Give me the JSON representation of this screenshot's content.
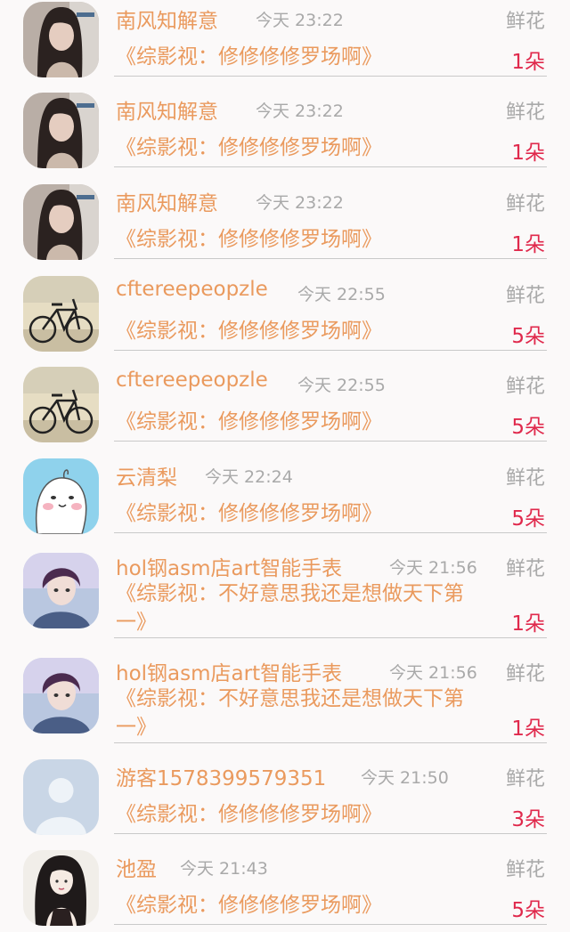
{
  "rows": [
    {
      "name": "南风知解意",
      "time": "今天 23:22",
      "gift": "鲜花",
      "book": "《综影视：修修修修罗场啊》",
      "count": "1朵",
      "avatar": "girl"
    },
    {
      "name": "南风知解意",
      "time": "今天 23:22",
      "gift": "鲜花",
      "book": "《综影视：修修修修罗场啊》",
      "count": "1朵",
      "avatar": "girl"
    },
    {
      "name": "南风知解意",
      "time": "今天 23:22",
      "gift": "鲜花",
      "book": "《综影视：修修修修罗场啊》",
      "count": "1朵",
      "avatar": "girl"
    },
    {
      "name": "cftereepeopzle",
      "time": "今天 22:55",
      "gift": "鲜花",
      "book": "《综影视：修修修修罗场啊》",
      "count": "5朵",
      "avatar": "bicycle"
    },
    {
      "name": "cftereepeopzle",
      "time": "今天 22:55",
      "gift": "鲜花",
      "book": "《综影视：修修修修罗场啊》",
      "count": "5朵",
      "avatar": "bicycle"
    },
    {
      "name": "云清梨",
      "time": "今天 22:24",
      "gift": "鲜花",
      "book": "《综影视：修修修修罗场啊》",
      "count": "5朵",
      "avatar": "cartoon"
    },
    {
      "name": "hol钢asm店art智能手表",
      "time": "今天 21:56",
      "gift": "鲜花",
      "book": "《综影视：不好意思我还是想做天下第一》",
      "count": "1朵",
      "avatar": "boy"
    },
    {
      "name": "hol钢asm店art智能手表",
      "time": "今天 21:56",
      "gift": "鲜花",
      "book": "《综影视：不好意思我还是想做天下第一》",
      "count": "1朵",
      "avatar": "boy"
    },
    {
      "name": "游客1578399579351",
      "time": "今天 21:50",
      "gift": "鲜花",
      "book": "《综影视：修修修修罗场啊》",
      "count": "3朵",
      "avatar": "default"
    },
    {
      "name": "池盈",
      "time": "今天 21:43",
      "gift": "鲜花",
      "book": "《综影视：修修修修罗场啊》",
      "count": "5朵",
      "avatar": "woman"
    }
  ]
}
